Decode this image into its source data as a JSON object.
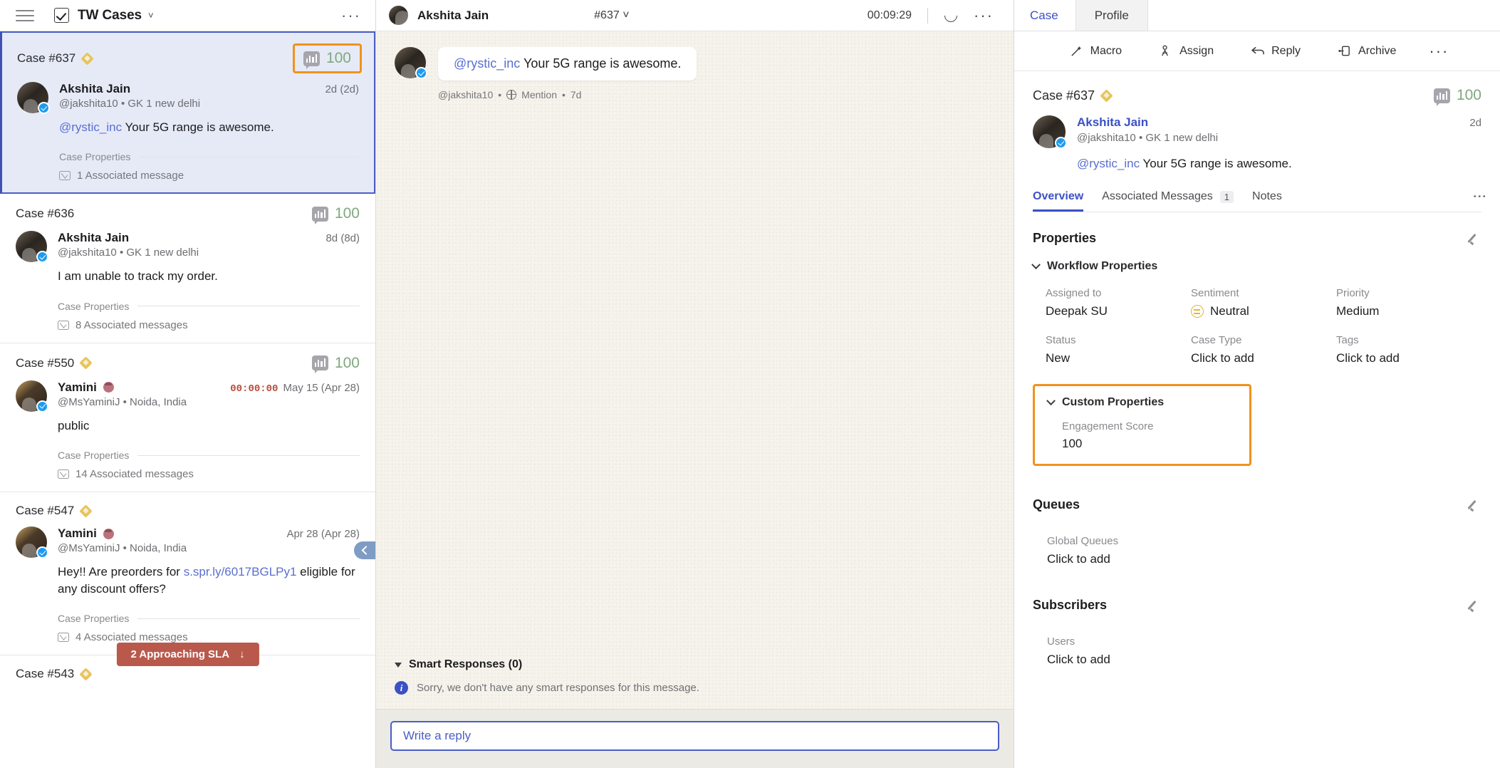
{
  "left": {
    "header": {
      "title": "TW Cases",
      "menu_icon": "hamburger-icon",
      "checkbox_icon": "checkbox-checked-icon",
      "chevron": "˅",
      "more": "···"
    },
    "sla_badge": {
      "label": "2 Approaching SLA",
      "arrow": "↓"
    },
    "cases": [
      {
        "case_id": "Case #637",
        "has_diamond": true,
        "score": "100",
        "score_highlighted": true,
        "name": "Akshita Jain",
        "handle": "@jakshita10 • GK 1 new delhi",
        "time": "2d (2d)",
        "timer": "",
        "mention": "@rystic_inc",
        "text": " Your 5G range is awesome.",
        "props_label": "Case Properties",
        "associated": "1 Associated message",
        "selected": true,
        "emoji_badge": false
      },
      {
        "case_id": "Case #636",
        "has_diamond": false,
        "score": "100",
        "score_highlighted": false,
        "name": "Akshita Jain",
        "handle": "@jakshita10 • GK 1 new delhi",
        "time": "8d (8d)",
        "timer": "",
        "mention": "",
        "text": "I am unable to track my order.",
        "props_label": "Case Properties",
        "associated": "8 Associated messages",
        "selected": false,
        "emoji_badge": false
      },
      {
        "case_id": "Case #550",
        "has_diamond": true,
        "score": "100",
        "score_highlighted": false,
        "name": "Yamini",
        "handle": "@MsYaminiJ • Noida, India",
        "time": "May 15 (Apr 28)",
        "timer": "00:00:00",
        "mention": "",
        "text": "public",
        "props_label": "Case Properties",
        "associated": "14 Associated messages",
        "selected": false,
        "emoji_badge": true
      },
      {
        "case_id": "Case #547",
        "has_diamond": true,
        "score": "",
        "score_highlighted": false,
        "name": "Yamini",
        "handle": "@MsYaminiJ • Noida, India",
        "time": "Apr 28 (Apr 28)",
        "timer": "",
        "mention": "",
        "text_before": "Hey!! Are preorders for ",
        "link": "s.spr.ly/6017BGLPy1",
        "text_after": " eligible for any discount offers?",
        "props_label": "Case Properties",
        "associated": "4 Associated messages",
        "selected": false,
        "emoji_badge": true
      },
      {
        "case_id": "Case #543",
        "has_diamond": true,
        "score": "",
        "partial": true
      }
    ]
  },
  "center": {
    "header": {
      "name": "Akshita Jain",
      "case": "#637",
      "chevron": "˅",
      "timer": "00:09:29",
      "refresh_icon": "refresh-icon",
      "more": "···"
    },
    "message": {
      "mention": "@rystic_inc",
      "text": " Your 5G range is awesome.",
      "meta_handle": "@jakshita10",
      "meta_type": "Mention",
      "meta_time": "7d",
      "sep": "•"
    },
    "smart_responses": {
      "title": "Smart Responses (0)",
      "empty_text": "Sorry, we don't have any smart responses for this message.",
      "info_icon": "info-icon"
    },
    "reply": {
      "placeholder": "Write a reply"
    }
  },
  "right": {
    "tabs": [
      {
        "label": "Case",
        "active": true
      },
      {
        "label": "Profile",
        "active": false
      }
    ],
    "toolbar": {
      "items": [
        {
          "label": "Macro",
          "icon": "magic-wand-icon"
        },
        {
          "label": "Assign",
          "icon": "assign-person-icon"
        },
        {
          "label": "Reply",
          "icon": "reply-arrow-icon"
        },
        {
          "label": "Archive",
          "icon": "archive-box-icon"
        }
      ],
      "more": "···"
    },
    "case": {
      "case_id": "Case #637",
      "score": "100",
      "name": "Akshita Jain",
      "handle": "@jakshita10 • GK 1 new delhi",
      "time": "2d",
      "mention": "@rystic_inc",
      "text": " Your 5G range is awesome."
    },
    "subtabs": [
      {
        "label": "Overview",
        "active": true,
        "badge": ""
      },
      {
        "label": "Associated Messages",
        "active": false,
        "badge": "1"
      },
      {
        "label": "Notes",
        "active": false,
        "badge": ""
      }
    ],
    "properties": {
      "title": "Properties",
      "workflow_group": "Workflow Properties",
      "fields": [
        {
          "label": "Assigned to",
          "value": "Deepak SU",
          "icon": ""
        },
        {
          "label": "Sentiment",
          "value": "Neutral",
          "icon": "neutral-face-icon"
        },
        {
          "label": "Priority",
          "value": "Medium",
          "icon": ""
        },
        {
          "label": "Status",
          "value": "New",
          "icon": ""
        },
        {
          "label": "Case Type",
          "value": "Click to add",
          "icon": ""
        },
        {
          "label": "Tags",
          "value": "Click to add",
          "icon": ""
        }
      ],
      "custom_group": "Custom Properties",
      "custom_label": "Engagement Score",
      "custom_value": "100"
    },
    "queues": {
      "title": "Queues",
      "label": "Global Queues",
      "value": "Click to add"
    },
    "subscribers": {
      "title": "Subscribers",
      "label": "Users",
      "value": "Click to add"
    }
  },
  "colors": {
    "accent_blue": "#3b51c4",
    "highlight_orange": "#f0921e",
    "score_green": "#7fa87f",
    "sla_red": "#b9594c",
    "selected_bg": "#e6eaf7"
  }
}
